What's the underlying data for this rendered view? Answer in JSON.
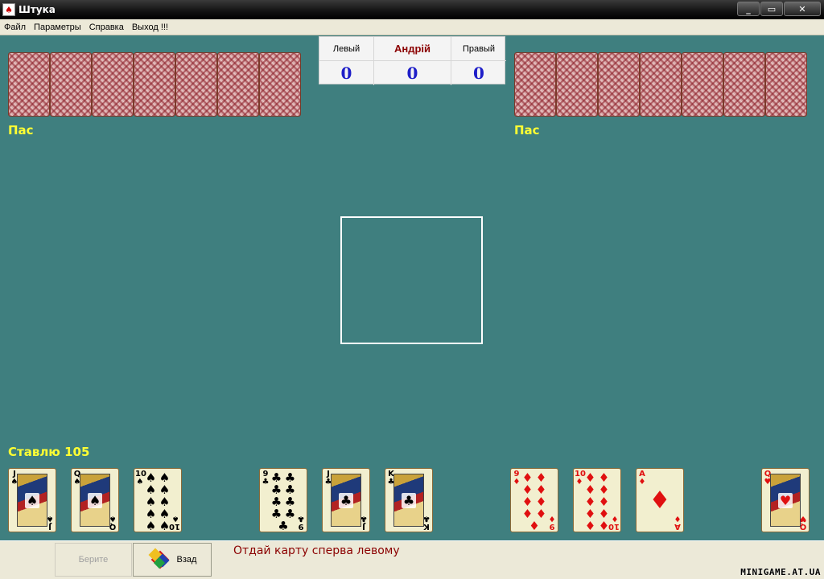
{
  "window": {
    "title": "Штука",
    "minimize": "_",
    "maximize": "▭",
    "close": "✕",
    "icon": "card-app-icon"
  },
  "menu": {
    "items": [
      "Файл",
      "Параметры",
      "Справка",
      "Выход !!!"
    ]
  },
  "score": {
    "left_label": "Левый",
    "me_label": "Андрій",
    "right_label": "Правый",
    "left_value": "0",
    "me_value": "0",
    "right_value": "0"
  },
  "left_opponent": {
    "status": "Пас",
    "card_count": 7
  },
  "right_opponent": {
    "status": "Пас",
    "card_count": 7
  },
  "player": {
    "bid": "Ставлю 105"
  },
  "hand": [
    {
      "rank": "J",
      "suit": "♠",
      "color": "black",
      "kind": "court"
    },
    {
      "rank": "Q",
      "suit": "♠",
      "color": "black",
      "kind": "court"
    },
    {
      "rank": "10",
      "suit": "♠",
      "color": "black",
      "kind": "pips",
      "count": 10
    },
    {
      "rank": "9",
      "suit": "♣",
      "color": "black",
      "kind": "pips",
      "count": 9
    },
    {
      "rank": "J",
      "suit": "♣",
      "color": "black",
      "kind": "court"
    },
    {
      "rank": "K",
      "suit": "♣",
      "color": "black",
      "kind": "court"
    },
    {
      "rank": "9",
      "suit": "♦",
      "color": "red",
      "kind": "pips",
      "count": 9
    },
    {
      "rank": "10",
      "suit": "♦",
      "color": "red",
      "kind": "pips",
      "count": 10
    },
    {
      "rank": "A",
      "suit": "♦",
      "color": "red",
      "kind": "ace"
    },
    {
      "rank": "Q",
      "suit": "♥",
      "color": "red",
      "kind": "court"
    }
  ],
  "bottom": {
    "take_button": "Берите",
    "back_button": "Взад",
    "message": "Отдай карту сперва левому",
    "watermark": "MINIGAME.AT.UA"
  }
}
